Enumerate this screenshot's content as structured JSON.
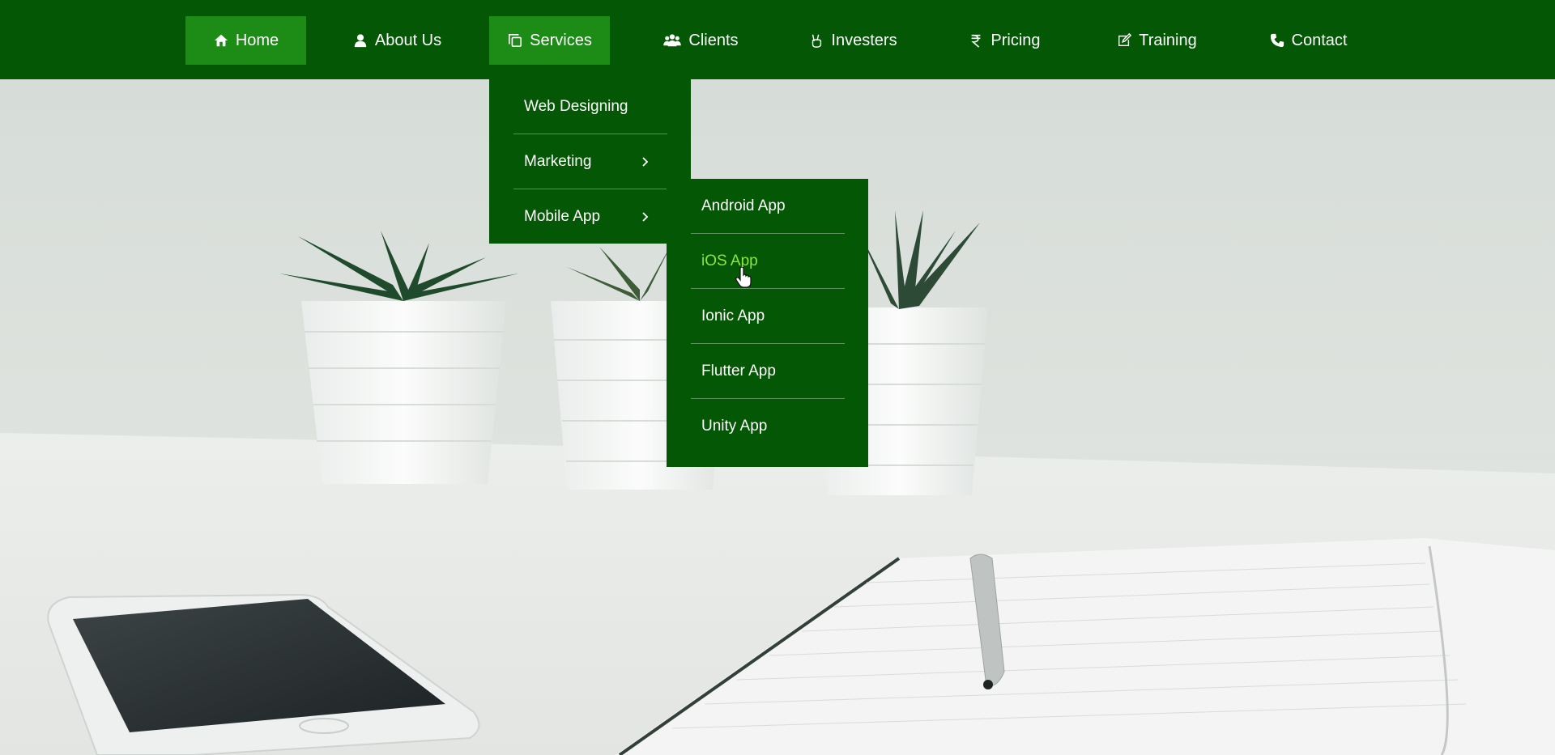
{
  "nav": {
    "items": [
      {
        "label": "Home",
        "icon": "home-icon",
        "active": true
      },
      {
        "label": "About Us",
        "icon": "user-icon"
      },
      {
        "label": "Services",
        "icon": "copy-icon",
        "active": true
      },
      {
        "label": "Clients",
        "icon": "users-icon"
      },
      {
        "label": "Investers",
        "icon": "peace-hand-icon"
      },
      {
        "label": "Pricing",
        "icon": "rupee-icon"
      },
      {
        "label": "Training",
        "icon": "edit-icon"
      },
      {
        "label": "Contact",
        "icon": "phone-icon"
      }
    ]
  },
  "services_menu": {
    "items": [
      {
        "label": "Web Designing"
      },
      {
        "label": "Marketing",
        "has_submenu": true
      },
      {
        "label": "Mobile App",
        "has_submenu": true
      }
    ]
  },
  "mobile_app_menu": {
    "items": [
      {
        "label": "Android App"
      },
      {
        "label": "iOS App",
        "hovered": true
      },
      {
        "label": "Ionic App"
      },
      {
        "label": "Flutter App"
      },
      {
        "label": "Unity App"
      }
    ]
  },
  "colors": {
    "nav_background": "#045704",
    "active_item": "#1d8c16",
    "hover_text": "#8ee63a",
    "text": "#ffffff"
  }
}
